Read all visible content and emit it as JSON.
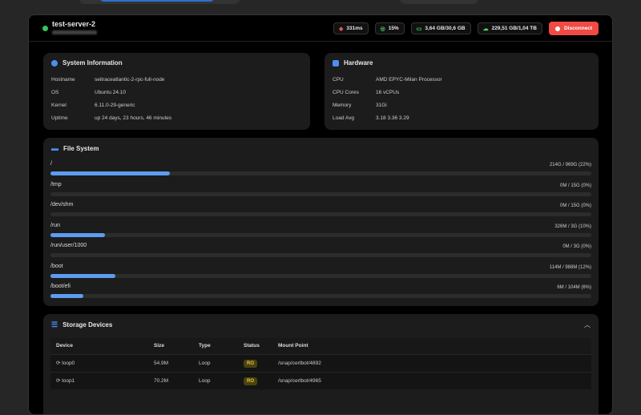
{
  "server": {
    "name": "test-server-2",
    "status_color": "#34c759"
  },
  "stats": {
    "latency": "331ms",
    "cpu": "15%",
    "memory": "3,64 GB/30,6 GB",
    "disk": "229,51 GB/1,04 TB"
  },
  "disconnect_label": "Disconnect",
  "system": {
    "title": "System Information",
    "rows": [
      {
        "k": "Hostname",
        "v": "seitraceatlantic-2-rpc-full-node"
      },
      {
        "k": "OS",
        "v": "Ubuntu 24.10"
      },
      {
        "k": "Kernel",
        "v": "6.11.0-29-generic"
      },
      {
        "k": "Uptime",
        "v": "up 24 days, 23 hours, 46 minutes"
      }
    ]
  },
  "hardware": {
    "title": "Hardware",
    "rows": [
      {
        "k": "CPU",
        "v": "AMD EPYC-Milan Processor"
      },
      {
        "k": "CPU Cores",
        "v": "16 vCPUs"
      },
      {
        "k": "Memory",
        "v": "31Gi"
      },
      {
        "k": "Load Avg",
        "v": "3.18 3.36 3.29"
      }
    ]
  },
  "filesystem": {
    "title": "File System",
    "items": [
      {
        "path": "/",
        "usage": "214G / 969G (22%)",
        "pct": 22
      },
      {
        "path": "/tmp",
        "usage": "0M / 15G (0%)",
        "pct": 0
      },
      {
        "path": "/dev/shm",
        "usage": "0M / 15G (0%)",
        "pct": 0
      },
      {
        "path": "/run",
        "usage": "326M / 3G (10%)",
        "pct": 10
      },
      {
        "path": "/run/user/1000",
        "usage": "0M / 3G (0%)",
        "pct": 0
      },
      {
        "path": "/boot",
        "usage": "114M / 988M (12%)",
        "pct": 12
      },
      {
        "path": "/boot/efi",
        "usage": "6M / 104M (6%)",
        "pct": 6
      }
    ]
  },
  "storage": {
    "title": "Storage Devices",
    "columns": [
      "Device",
      "Size",
      "Type",
      "Status",
      "Mount Point"
    ],
    "rows": [
      {
        "device": "loop0",
        "size": "54.9M",
        "type": "Loop",
        "status": "RO",
        "mount": "/snap/certbot/4892"
      },
      {
        "device": "loop1",
        "size": "70.2M",
        "type": "Loop",
        "status": "RO",
        "mount": "/snap/certbot/4965"
      }
    ]
  }
}
